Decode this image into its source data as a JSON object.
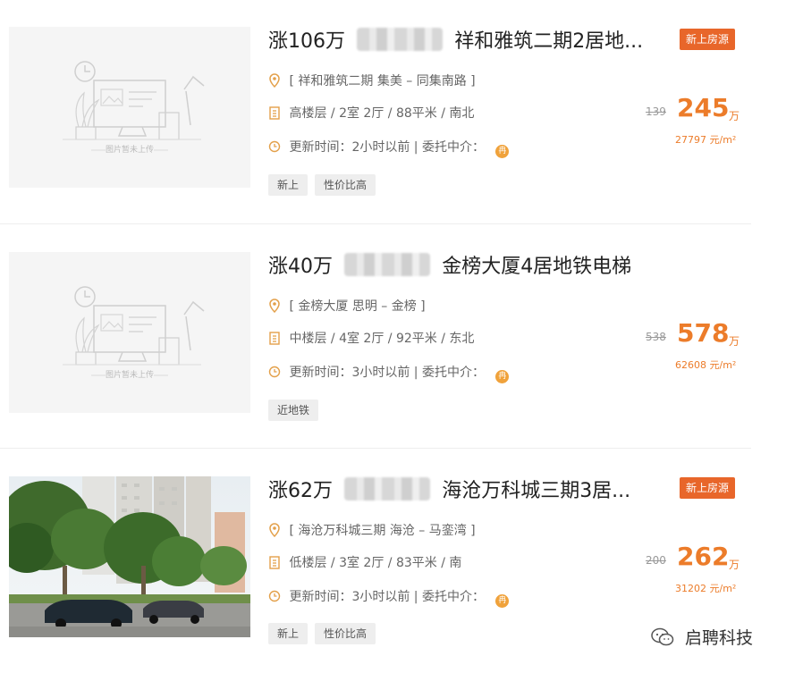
{
  "listings": [
    {
      "rise": "涨106万",
      "name": "祥和雅筑二期2居地...",
      "badge": "新上房源",
      "location": "[ 祥和雅筑二期 集美 – 同集南路 ]",
      "specs": "高楼层 / 2室 2厅 / 88平米 / 南北",
      "update": "更新时间：2小时以前 | 委托中介：",
      "agent_badge": "冉",
      "tags": [
        "新上",
        "性价比高"
      ],
      "old_price": "139",
      "price": "245",
      "price_unit": "万",
      "unit_price": "27797 元/m²",
      "image": "placeholder",
      "placeholder_caption": "图片暂未上传"
    },
    {
      "rise": "涨40万",
      "name": "金榜大厦4居地铁电梯",
      "badge": "",
      "location": "[ 金榜大厦 思明 – 金榜 ]",
      "specs": "中楼层 / 4室 2厅 / 92平米 / 东北",
      "update": "更新时间：3小时以前 | 委托中介：",
      "agent_badge": "冉",
      "tags": [
        "近地铁"
      ],
      "old_price": "538",
      "price": "578",
      "price_unit": "万",
      "unit_price": "62608 元/m²",
      "image": "placeholder",
      "placeholder_caption": "图片暂未上传"
    },
    {
      "rise": "涨62万",
      "name": "海沧万科城三期3居...",
      "badge": "新上房源",
      "location": "[ 海沧万科城三期 海沧 – 马銮湾 ]",
      "specs": "低楼层 / 3室 2厅 / 83平米 / 南",
      "update": "更新时间：3小时以前 | 委托中介：",
      "agent_badge": "冉",
      "tags": [
        "新上",
        "性价比高"
      ],
      "old_price": "200",
      "price": "262",
      "price_unit": "万",
      "unit_price": "31202 元/m²",
      "image": "photo",
      "placeholder_caption": ""
    }
  ],
  "watermark": "启聘科技",
  "colors": {
    "accent": "#ec7c2a",
    "badge_bg": "#e8662a",
    "tag_bg": "#eeeeee",
    "agent_badge": "#f0a23b"
  },
  "icons": {
    "location": "location-pin-icon",
    "specs": "building-icon",
    "update": "clock-icon",
    "watermark": "wechat-icon"
  }
}
